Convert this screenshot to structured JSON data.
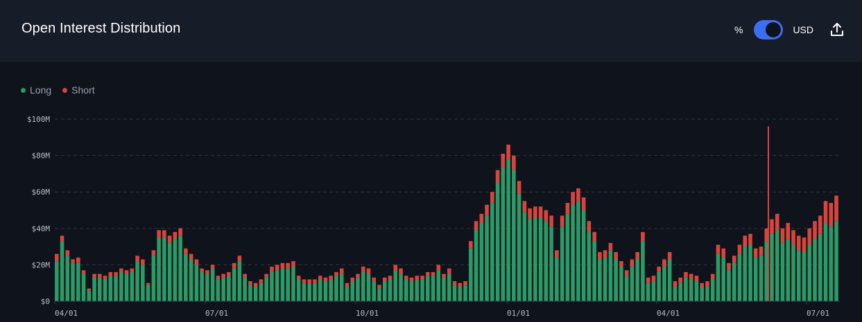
{
  "header": {
    "title": "Open Interest Distribution",
    "toggle_left_label": "%",
    "toggle_right_label": "USD",
    "share_icon": "share-icon"
  },
  "colors": {
    "long": "#2c9a66",
    "short": "#d9453d",
    "grid": "#2e3441",
    "accent": "#3b6ef5"
  },
  "chart_data": {
    "type": "bar",
    "stacked": true,
    "title": "Open Interest Distribution",
    "legend": [
      {
        "name": "Long",
        "color": "#2c9a66"
      },
      {
        "name": "Short",
        "color": "#d9453d"
      }
    ],
    "legend_position": "top-left",
    "y_ticks": [
      "$0",
      "$20M",
      "$40M",
      "$60M",
      "$80M",
      "$100M"
    ],
    "ylim": [
      0,
      100
    ],
    "y_unit": "$M",
    "x_ticks": [
      "04/01",
      "07/01",
      "10/01",
      "01/01",
      "04/01",
      "07/01"
    ],
    "grid": "horizontal dashed",
    "sampling": "every 4 days",
    "total": [
      26,
      36,
      28,
      23,
      24,
      17,
      7,
      15,
      15,
      14,
      16,
      16,
      18,
      17,
      18,
      25,
      23,
      10,
      28,
      39,
      39,
      36,
      38,
      40,
      29,
      26,
      23,
      18,
      17,
      20,
      14,
      15,
      16,
      21,
      25,
      15,
      11,
      10,
      12,
      15,
      19,
      20,
      21,
      21,
      22,
      14,
      12,
      12,
      12,
      14,
      13,
      14,
      16,
      18,
      10,
      13,
      15,
      19,
      18,
      13,
      9,
      13,
      14,
      20,
      18,
      14,
      13,
      14,
      14,
      16,
      16,
      20,
      15,
      18,
      11,
      10,
      11,
      33,
      44,
      48,
      53,
      60,
      72,
      81,
      86,
      80,
      66,
      55,
      51,
      52,
      52,
      50,
      47,
      28,
      47,
      54,
      60,
      62,
      57,
      44,
      38,
      27,
      28,
      32,
      27,
      22,
      17,
      23,
      27,
      38,
      13,
      14,
      19,
      23,
      27,
      11,
      13,
      16,
      15,
      14,
      10,
      11,
      15,
      31,
      29,
      21,
      25,
      31,
      36,
      37,
      29,
      30,
      40,
      45,
      48,
      40,
      43,
      39,
      36,
      35,
      40,
      44,
      47,
      55,
      54,
      58
    ],
    "short": [
      4,
      3,
      3,
      2,
      3,
      2,
      1,
      2,
      2,
      2,
      2,
      2,
      2,
      2,
      2,
      3,
      3,
      1,
      3,
      4,
      4,
      4,
      4,
      4,
      3,
      3,
      3,
      2,
      2,
      2,
      2,
      2,
      2,
      3,
      3,
      2,
      2,
      2,
      2,
      2,
      3,
      3,
      3,
      3,
      3,
      2,
      2,
      2,
      2,
      2,
      2,
      2,
      2,
      3,
      2,
      2,
      2,
      3,
      3,
      2,
      2,
      2,
      2,
      3,
      3,
      2,
      2,
      2,
      2,
      2,
      2,
      3,
      2,
      3,
      2,
      2,
      2,
      4,
      5,
      5,
      6,
      6,
      7,
      8,
      8,
      8,
      7,
      6,
      6,
      6,
      6,
      6,
      6,
      4,
      6,
      6,
      7,
      7,
      7,
      6,
      5,
      4,
      4,
      4,
      4,
      3,
      3,
      4,
      4,
      5,
      3,
      3,
      3,
      4,
      4,
      3,
      3,
      3,
      3,
      3,
      2,
      3,
      3,
      5,
      5,
      4,
      4,
      5,
      6,
      6,
      5,
      5,
      7,
      8,
      9,
      8,
      9,
      8,
      8,
      8,
      9,
      10,
      10,
      12,
      13,
      14
    ],
    "spikes": [
      {
        "date": "05/23",
        "value": 96
      }
    ]
  }
}
